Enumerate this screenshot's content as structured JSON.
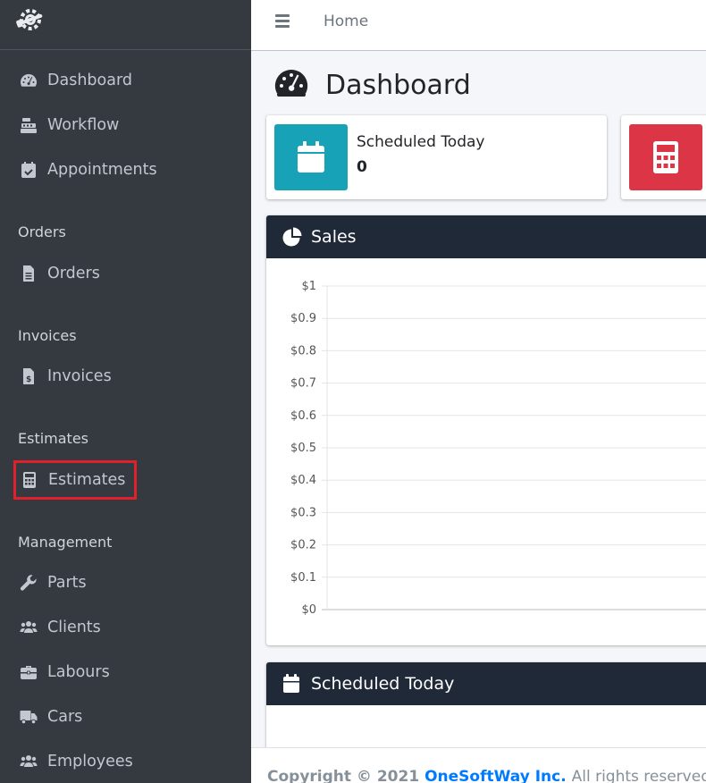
{
  "sidebar": {
    "items": [
      {
        "label": "Dashboard",
        "icon": "tachometer-icon"
      },
      {
        "label": "Workflow",
        "icon": "cash-register-icon"
      },
      {
        "label": "Appointments",
        "icon": "calendar-check-icon"
      }
    ],
    "sections": [
      {
        "header": "Orders",
        "items": [
          {
            "label": "Orders",
            "icon": "file-alt-icon"
          }
        ]
      },
      {
        "header": "Invoices",
        "items": [
          {
            "label": "Invoices",
            "icon": "file-invoice-dollar-icon"
          }
        ]
      },
      {
        "header": "Estimates",
        "items": [
          {
            "label": "Estimates",
            "icon": "calculator-icon"
          }
        ]
      },
      {
        "header": "Management",
        "items": [
          {
            "label": "Parts",
            "icon": "wrench-icon"
          },
          {
            "label": "Clients",
            "icon": "users-icon"
          },
          {
            "label": "Labours",
            "icon": "briefcase-icon"
          },
          {
            "label": "Cars",
            "icon": "truck-icon"
          },
          {
            "label": "Employees",
            "icon": "users-icon"
          }
        ]
      }
    ]
  },
  "navbar": {
    "home": "Home"
  },
  "page": {
    "title": "Dashboard"
  },
  "info_boxes": [
    {
      "label": "Scheduled Today",
      "value": "0",
      "color": "#17a2b8",
      "icon": "calendar-icon"
    },
    {
      "color": "#dc3545",
      "icon": "calculator-icon"
    }
  ],
  "sales_card": {
    "title": "Sales"
  },
  "scheduled_card": {
    "title": "Scheduled Today"
  },
  "footer": {
    "copyright": "Copyright © 2021",
    "company": "OneSoftWay Inc.",
    "rest": "All rights reserved."
  },
  "chart_data": {
    "type": "line",
    "yticks": [
      "$1",
      "$0.9",
      "$0.8",
      "$0.7",
      "$0.6",
      "$0.5",
      "$0.4",
      "$0.3",
      "$0.2",
      "$0.1",
      "$0"
    ],
    "ylim": [
      0,
      1
    ],
    "series": [],
    "grid": true
  },
  "colors": {
    "sidebar": "#343a40",
    "card_header": "#1f2937",
    "highlight": "#e0202a",
    "link": "#007bff"
  }
}
